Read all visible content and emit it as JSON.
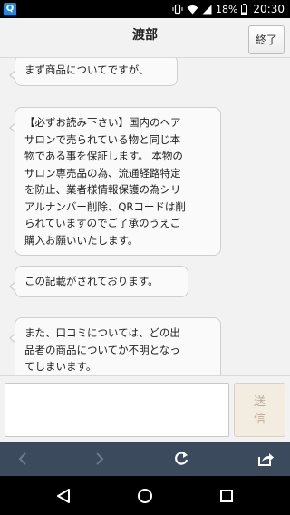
{
  "status_bar": {
    "app_icon_label": "Q",
    "battery": "18%",
    "time": "20:30",
    "icons": [
      "app-notification-icon",
      "vibrate-icon",
      "wifi-icon",
      "signal-icon",
      "battery-icon"
    ]
  },
  "header": {
    "title": "渡部",
    "close_label": "終了"
  },
  "messages": [
    {
      "lines": [
        "まず商品についてですが、"
      ]
    },
    {
      "lines": [
        "【必ずお読み下さい】国内のヘア",
        "サロンで売られている物と同じ本",
        "物である事を保証します。 本物の",
        "サロン専売品の為、流通経路特定",
        "を防止、業者様情報保護の為シリ",
        "アルナンバー削除、QRコードは削",
        "られていますのでご了承のうえご",
        "購入お願いいたします。"
      ]
    },
    {
      "lines": [
        "この記載がされております。"
      ]
    },
    {
      "lines": [
        "また、口コミについては、どの出",
        "品者の商品についてか不明となっ",
        "てしまいます。"
      ]
    }
  ],
  "composer": {
    "input_value": "",
    "send_label_line1": "送",
    "send_label_line2": "信"
  },
  "toolbar": {
    "icons": [
      "back-icon",
      "forward-icon",
      "reload-icon",
      "share-icon"
    ]
  },
  "navbar": {
    "icons": [
      "nav-back-icon",
      "nav-home-icon",
      "nav-recents-icon"
    ]
  },
  "colors": {
    "toolbar_bg": "#3c4a5d",
    "chat_bg": "#f2f2f2",
    "bubble_bg": "#fafafa",
    "send_button_bg": "#f3ece0"
  }
}
